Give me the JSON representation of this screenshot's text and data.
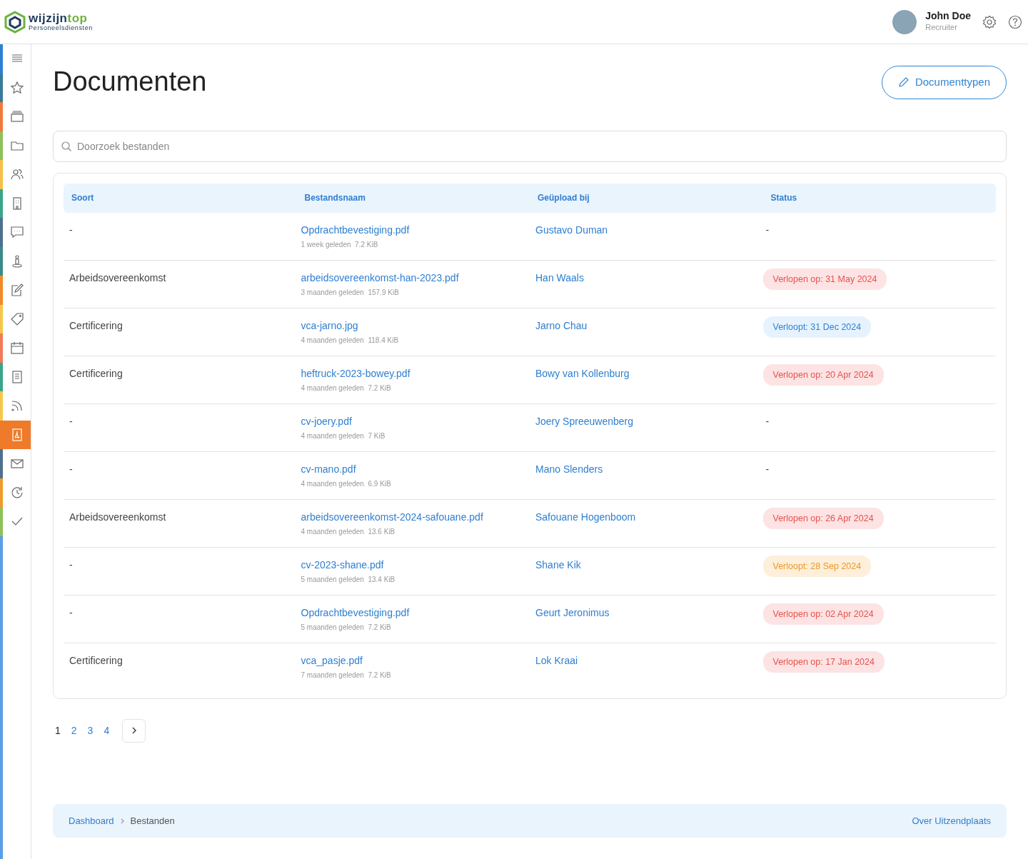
{
  "brand": {
    "name": "wijzijn",
    "name_accent": "top",
    "tagline": "Personeelsdiensten"
  },
  "user": {
    "name": "John Doe",
    "role": "Recruiter"
  },
  "sidebar": {
    "items": [
      {
        "color": "#2f7fd6",
        "selected": false
      },
      {
        "color": "#3a7a9a",
        "selected": false
      },
      {
        "color": "#ef7a3a",
        "selected": false
      },
      {
        "color": "#8fbf5a",
        "selected": false
      },
      {
        "color": "#f5c04a",
        "selected": false
      },
      {
        "color": "#3aa58a",
        "selected": false
      },
      {
        "color": "#4f6f8f",
        "selected": false
      },
      {
        "color": "#3a8a8a",
        "selected": false
      },
      {
        "color": "#f08a2a",
        "selected": false
      },
      {
        "color": "#f5c84a",
        "selected": false
      },
      {
        "color": "#f07a5a",
        "selected": false
      },
      {
        "color": "#3aa58a",
        "selected": false
      },
      {
        "color": "#f5c84a",
        "selected": false
      },
      {
        "color": "#ef7a2a",
        "selected": true
      },
      {
        "color": "#4f6f8f",
        "selected": false
      },
      {
        "color": "#f09a2a",
        "selected": false
      },
      {
        "color": "#8fbf5a",
        "selected": false
      }
    ]
  },
  "page": {
    "title": "Documenten",
    "action_button": "Documenttypen"
  },
  "search": {
    "placeholder": "Doorzoek bestanden"
  },
  "table": {
    "columns": [
      "Soort",
      "Bestandsnaam",
      "Geüpload bij",
      "Status"
    ],
    "rows": [
      {
        "soort": "-",
        "file": "Opdrachtbevestiging.pdf",
        "age": "1 week geleden",
        "size": "7.2 KiB",
        "uploader": "Gustavo Duman",
        "status": {
          "kind": "none",
          "text": "-"
        }
      },
      {
        "soort": "Arbeidsovereenkomst",
        "file": "arbeidsovereenkomst-han-2023.pdf",
        "age": "3 maanden geleden",
        "size": "157.9 KiB",
        "uploader": "Han Waals",
        "status": {
          "kind": "expired",
          "text": "Verlopen op: 31 May 2024"
        }
      },
      {
        "soort": "Certificering",
        "file": "vca-jarno.jpg",
        "age": "4 maanden geleden",
        "size": "118.4 KiB",
        "uploader": "Jarno Chau",
        "status": {
          "kind": "valid",
          "text": "Verloopt: 31 Dec 2024"
        }
      },
      {
        "soort": "Certificering",
        "file": "heftruck-2023-bowey.pdf",
        "age": "4 maanden geleden",
        "size": "7.2 KiB",
        "uploader": "Bowy van Kollenburg",
        "status": {
          "kind": "expired",
          "text": "Verlopen op: 20 Apr 2024"
        }
      },
      {
        "soort": "-",
        "file": "cv-joery.pdf",
        "age": "4 maanden geleden",
        "size": "7 KiB",
        "uploader": "Joery Spreeuwenberg",
        "status": {
          "kind": "none",
          "text": "-"
        }
      },
      {
        "soort": "-",
        "file": "cv-mano.pdf",
        "age": "4 maanden geleden",
        "size": "6.9 KiB",
        "uploader": "Mano Slenders",
        "status": {
          "kind": "none",
          "text": "-"
        }
      },
      {
        "soort": "Arbeidsovereenkomst",
        "file": "arbeidsovereenkomst-2024-safouane.pdf",
        "age": "4 maanden geleden",
        "size": "13.6 KiB",
        "uploader": "Safouane Hogenboom",
        "status": {
          "kind": "expired",
          "text": "Verlopen op: 26 Apr 2024"
        }
      },
      {
        "soort": "-",
        "file": "cv-2023-shane.pdf",
        "age": "5 maanden geleden",
        "size": "13.4 KiB",
        "uploader": "Shane Kik",
        "status": {
          "kind": "warning",
          "text": "Verloopt: 28 Sep 2024"
        }
      },
      {
        "soort": "-",
        "file": "Opdrachtbevestiging.pdf",
        "age": "5 maanden geleden",
        "size": "7.2 KiB",
        "uploader": "Geurt Jeronimus",
        "status": {
          "kind": "expired",
          "text": "Verlopen op: 02 Apr 2024"
        }
      },
      {
        "soort": "Certificering",
        "file": "vca_pasje.pdf",
        "age": "7 maanden geleden",
        "size": "7.2 KiB",
        "uploader": "Lok Kraai",
        "status": {
          "kind": "expired",
          "text": "Verlopen op: 17 Jan 2024"
        }
      }
    ]
  },
  "pagination": {
    "pages": [
      {
        "label": "1",
        "selected": true
      },
      {
        "label": "2",
        "selected": false
      },
      {
        "label": "3",
        "selected": false
      },
      {
        "label": "4",
        "selected": false
      }
    ]
  },
  "footer": {
    "breadcrumb": [
      "Dashboard",
      "Bestanden"
    ],
    "link": "Over Uitzendplaats"
  }
}
